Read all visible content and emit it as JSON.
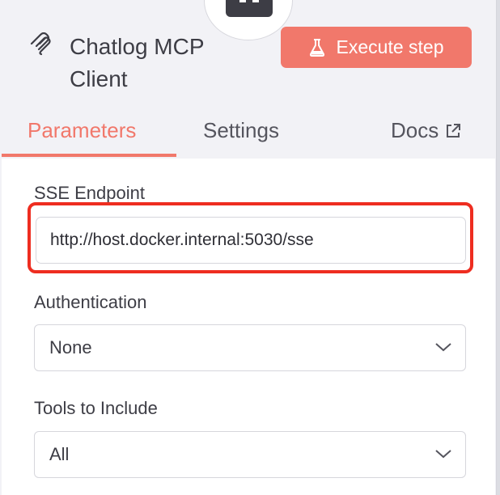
{
  "header": {
    "title": "Chatlog MCP Client",
    "title_icon": "mcp-icon",
    "node_icon": "robot-icon",
    "execute_button": {
      "label": "Execute step",
      "icon": "flask-icon",
      "color": "#f1786b"
    }
  },
  "tabs": [
    {
      "label": "Parameters",
      "active": true
    },
    {
      "label": "Settings",
      "active": false
    },
    {
      "label": "Docs",
      "icon": "external-link-icon",
      "active": false
    }
  ],
  "form": {
    "sse_endpoint": {
      "label": "SSE Endpoint",
      "value": "http://host.docker.internal:5030/sse"
    },
    "authentication": {
      "label": "Authentication",
      "value": "None"
    },
    "tools_to_include": {
      "label": "Tools to Include",
      "value": "All"
    }
  },
  "colors": {
    "accent": "#f1786b",
    "highlight": "#ee2d20"
  }
}
